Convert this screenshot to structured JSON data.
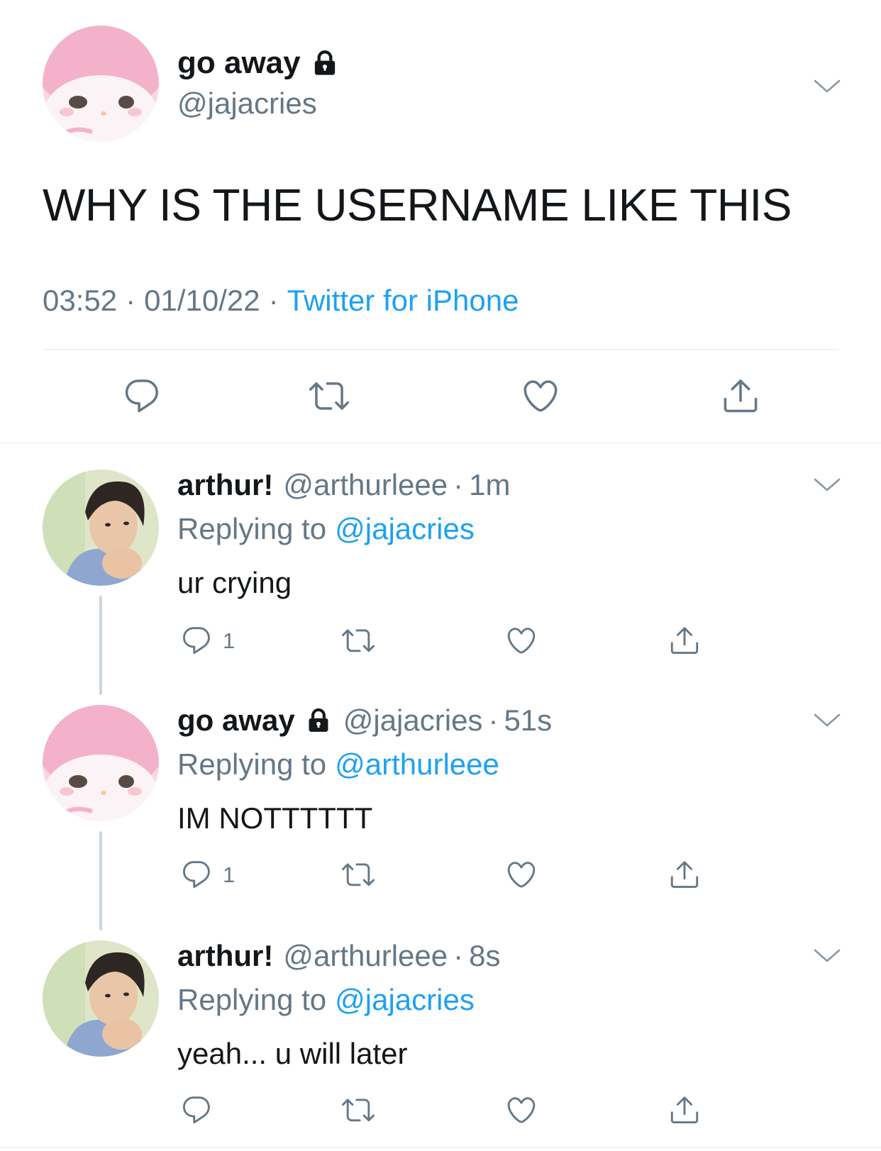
{
  "main_tweet": {
    "display_name": "go away",
    "handle": "@jajacries",
    "text": "WHY IS THE USERNAME LIKE THIS",
    "time": "03:52",
    "date": "01/10/22",
    "source": "Twitter for iPhone"
  },
  "replies": [
    {
      "display_name": "arthur!",
      "handle": "@arthurleee",
      "age": "1m",
      "replying_label": "Replying to",
      "replying_to": "@jajacries",
      "text": "ur crying",
      "reply_count": "1"
    },
    {
      "display_name": "go away",
      "handle": "@jajacries",
      "age": "51s",
      "replying_label": "Replying to",
      "replying_to": "@arthurleee",
      "text": "IM NOTTTTTT",
      "reply_count": "1"
    },
    {
      "display_name": "arthur!",
      "handle": "@arthurleee",
      "age": "8s",
      "replying_label": "Replying to",
      "replying_to": "@jajacries",
      "text": "yeah... u will later",
      "reply_count": ""
    }
  ],
  "separator": "·",
  "icons": {
    "lock": "lock-icon",
    "chevron": "chevron-down-icon",
    "reply": "reply-icon",
    "retweet": "retweet-icon",
    "like": "heart-icon",
    "share": "share-icon"
  },
  "colors": {
    "link": "#1da1f2",
    "secondary_text": "#657786",
    "icon": "#657786",
    "divider": "#e1e8ed"
  }
}
